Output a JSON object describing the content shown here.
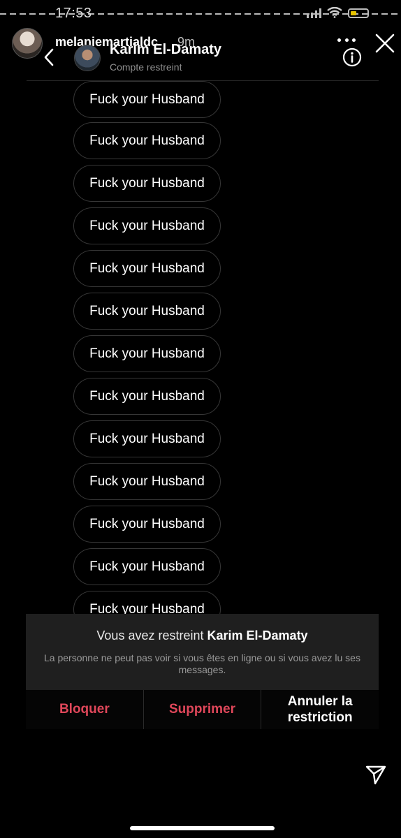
{
  "status_bar": {
    "time": "17:53"
  },
  "story": {
    "username": "melaniemartialdc",
    "time_ago": "9m"
  },
  "dm_header": {
    "name": "Karim El-Damaty",
    "subtitle": "Compte restreint"
  },
  "messages": [
    "Fuck your Husband",
    "Fuck your Husband",
    "Fuck your Husband",
    "Fuck your Husband",
    "Fuck your Husband",
    "Fuck your Husband",
    "Fuck your Husband",
    "Fuck your Husband",
    "Fuck your Husband",
    "Fuck your Husband",
    "Fuck your Husband",
    "Fuck your Husband",
    "Fuck your Husband"
  ],
  "restriction": {
    "title_prefix": "Vous avez restreint",
    "title_name": "Karim El-Damaty",
    "description": "La personne ne peut pas voir si vous êtes en ligne ou si vous avez lu ses messages."
  },
  "actions": {
    "block": "Bloquer",
    "delete": "Supprimer",
    "unrestrict": "Annuler la restriction"
  },
  "colors": {
    "background": "#000000",
    "danger": "#e0475a",
    "panel": "#1f1f1f"
  },
  "icons": [
    "back-icon",
    "info-icon",
    "more-icon",
    "close-icon",
    "send-icon",
    "wifi-icon",
    "battery-icon",
    "signal-icon"
  ]
}
